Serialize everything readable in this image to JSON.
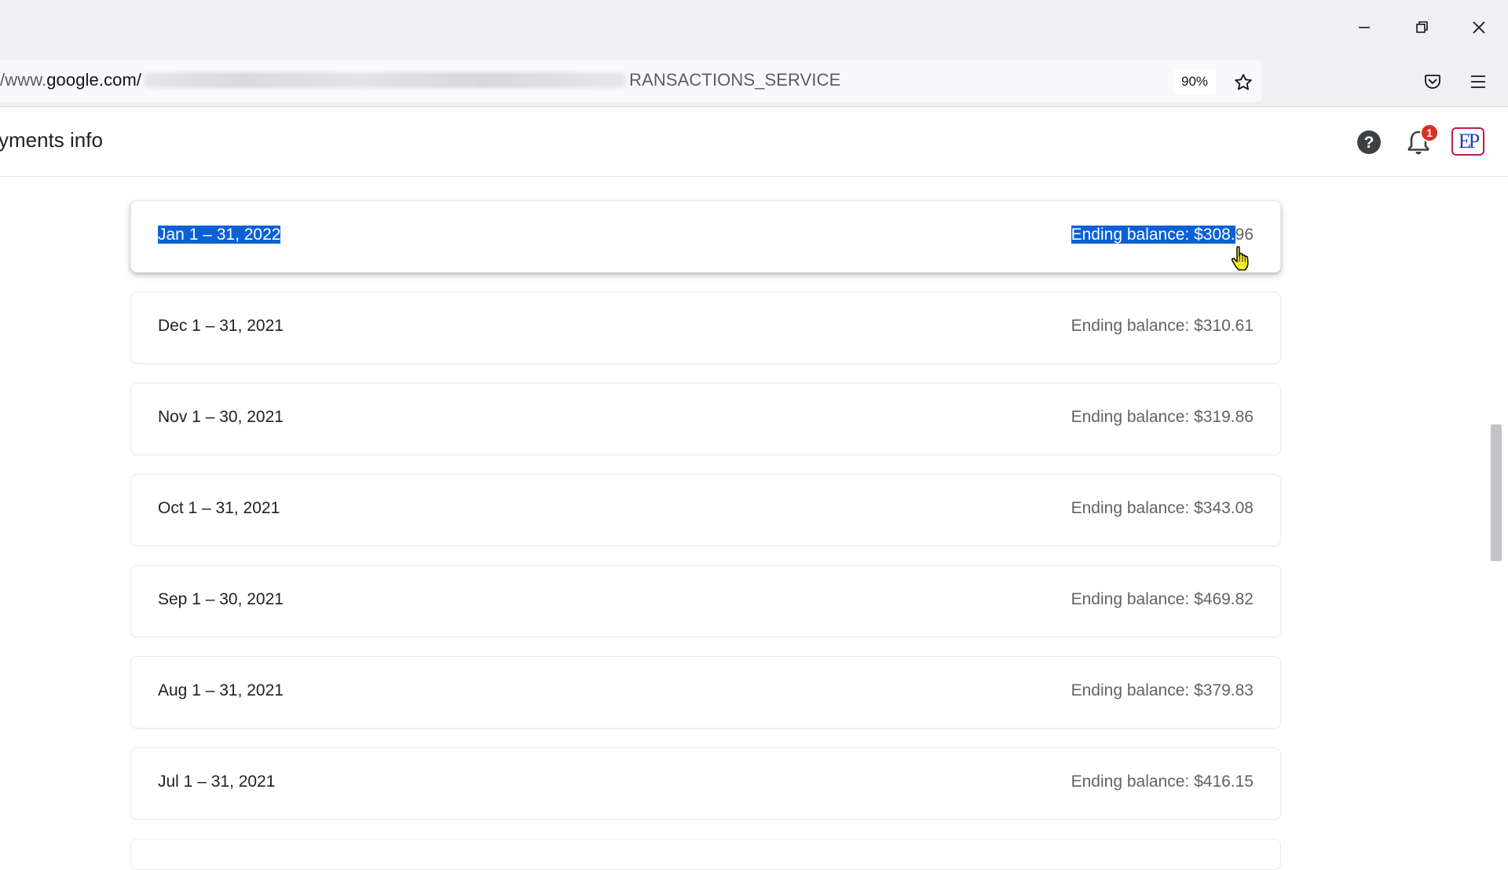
{
  "browser": {
    "url_prefix": "/www.",
    "url_domain": "google.com/",
    "url_suffix": "RANSACTIONS_SERVICE",
    "zoom_level": "90%"
  },
  "page": {
    "title": "yments info",
    "notification_count": "1",
    "avatar_initials": "EP"
  },
  "statements": [
    {
      "period_selected": "Jan 1 – 31, 2022",
      "balance_selected": "Ending balance: $308.",
      "balance_rest": "96"
    },
    {
      "period": "Dec 1 – 31, 2021",
      "balance": "Ending balance: $310.61"
    },
    {
      "period": "Nov 1 – 30, 2021",
      "balance": "Ending balance: $319.86"
    },
    {
      "period": "Oct 1 – 31, 2021",
      "balance": "Ending balance: $343.08"
    },
    {
      "period": "Sep 1 – 30, 2021",
      "balance": "Ending balance: $469.82"
    },
    {
      "period": "Aug 1 – 31, 2021",
      "balance": "Ending balance: $379.83"
    },
    {
      "period": "Jul 1 – 31, 2021",
      "balance": "Ending balance: $416.15"
    }
  ],
  "colors": {
    "selection_highlight": "#0a61d6",
    "notification_badge": "#d93025",
    "avatar_border": "#c2185b",
    "avatar_text": "#1a3fb5"
  },
  "icons": {
    "window": [
      "minimize-icon",
      "restore-icon",
      "close-icon"
    ],
    "toolbar": [
      "bookmark-star-icon",
      "pocket-icon",
      "hamburger-menu-icon"
    ],
    "header": [
      "help-icon",
      "bell-icon"
    ],
    "cursor": "hand-pointer-cursor"
  }
}
